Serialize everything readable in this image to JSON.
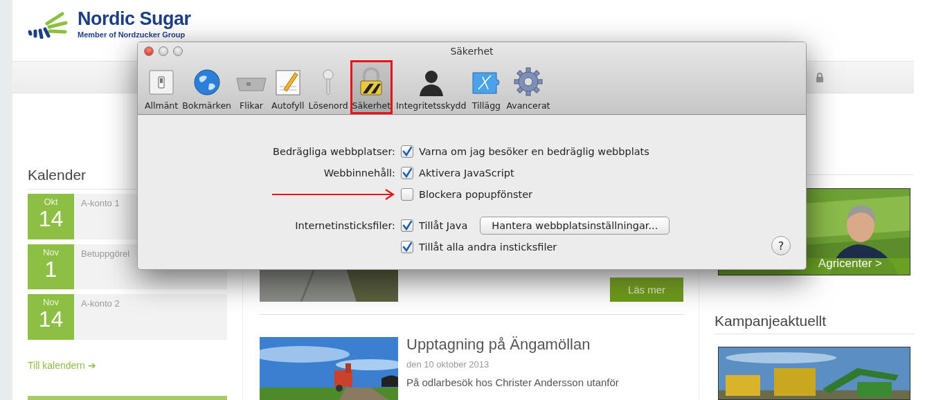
{
  "site": {
    "logo_name": "Nordic Sugar",
    "logo_tagline": "Member of Nordzucker Group"
  },
  "calendar": {
    "title": "Kalender",
    "events": [
      {
        "month": "Okt",
        "day": "14",
        "title": "A-konto 1"
      },
      {
        "month": "Nov",
        "day": "1",
        "title": "Betuppgörel"
      },
      {
        "month": "Nov",
        "day": "14",
        "title": "A-konto 2"
      }
    ],
    "link": "Till kalendern ➔"
  },
  "articles": [
    {
      "button": "Läs mer"
    },
    {
      "title": "Upptagning på Ängamöllan",
      "date": "den 10 oktober 2013",
      "excerpt": "På odlarbesök hos Christer Andersson utanför"
    }
  ],
  "sidebar": {
    "promo": "Agricenter >",
    "heading": "Kampanjeaktuellt"
  },
  "dialog": {
    "title": "Säkerhet",
    "toolbar": [
      {
        "label": "Allmänt",
        "selected": false,
        "highlighted": false
      },
      {
        "label": "Bokmärken",
        "selected": false,
        "highlighted": false
      },
      {
        "label": "Flikar",
        "selected": false,
        "highlighted": false
      },
      {
        "label": "Autofyll",
        "selected": false,
        "highlighted": false
      },
      {
        "label": "Lösenord",
        "selected": false,
        "highlighted": false
      },
      {
        "label": "Säkerhet",
        "selected": true,
        "highlighted": true
      },
      {
        "label": "Integritetsskydd",
        "selected": false,
        "highlighted": false
      },
      {
        "label": "Tillägg",
        "selected": false,
        "highlighted": false
      },
      {
        "label": "Avancerat",
        "selected": false,
        "highlighted": false
      }
    ],
    "lines": [
      {
        "label": "Bedrägliga webbplatser:",
        "option": "Varna om jag besöker en bedräglig webbplats",
        "checked": true
      },
      {
        "label": "Webbinnehåll:",
        "option": "Aktivera JavaScript",
        "checked": true
      },
      {
        "option": "Blockera popupfönster",
        "checked": false,
        "annotated": true
      },
      {
        "label": "Internetinsticksfiler:",
        "option": "Tillåt Java",
        "checked": true,
        "button": "Hantera webbplatsinställningar...",
        "gap_before": true
      },
      {
        "option": "Tillåt alla andra insticksfiler",
        "checked": true
      }
    ],
    "help": "?"
  }
}
